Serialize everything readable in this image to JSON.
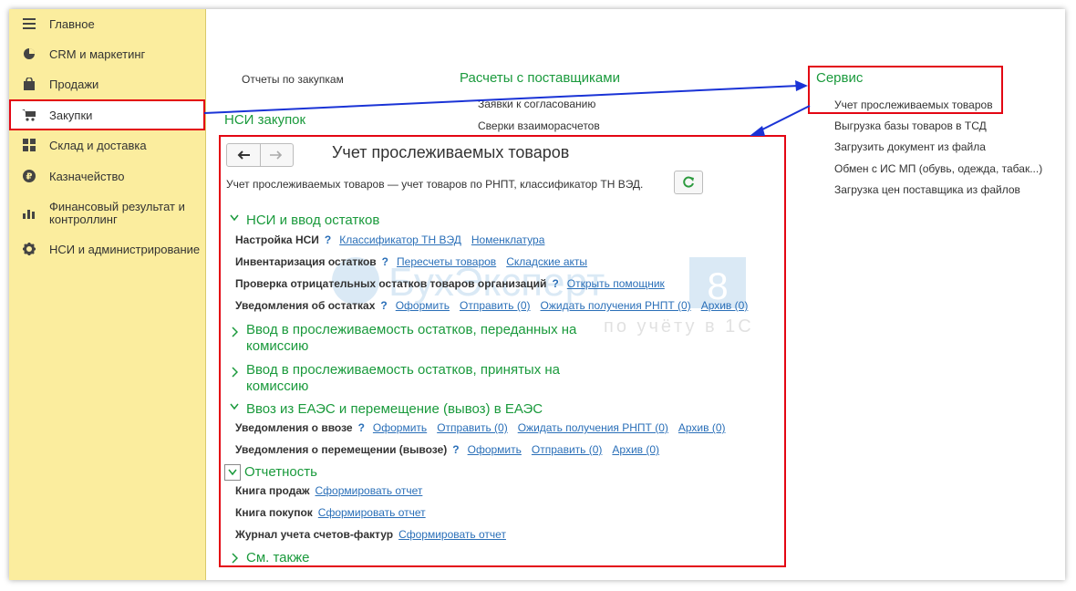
{
  "sidebar": {
    "items": [
      {
        "label": "Главное",
        "icon": "menu-icon"
      },
      {
        "label": "CRM и маркетинг",
        "icon": "pie-chart-icon"
      },
      {
        "label": "Продажи",
        "icon": "shopping-bag-icon"
      },
      {
        "label": "Закупки",
        "icon": "cart-icon"
      },
      {
        "label": "Склад и доставка",
        "icon": "warehouse-icon"
      },
      {
        "label": "Казначейство",
        "icon": "ruble-coin-icon"
      },
      {
        "label": "Финансовый результат и контроллинг",
        "icon": "bar-chart-icon"
      },
      {
        "label": "НСИ и администрирование",
        "icon": "gear-icon"
      }
    ],
    "active": "Закупки"
  },
  "main": {
    "reports_link": "Отчеты по закупкам",
    "settlements_header": "Расчеты с поставщиками",
    "approval_link": "Заявки к согласованию",
    "reconciliation_link": "Сверки взаиморасчетов",
    "nsi_header": "НСИ закупок"
  },
  "service": {
    "title": "Сервис",
    "items": [
      "Учет прослеживаемых товаров",
      "Выгрузка базы товаров в ТСД",
      "Загрузить документ из файла",
      "Обмен с ИС МП (обувь, одежда, табак...)",
      "Загрузка цен поставщика из файлов"
    ]
  },
  "panel": {
    "title": "Учет прослеживаемых товаров",
    "description": "Учет прослеживаемых товаров — учет товаров по РНПТ, классификатор ТН ВЭД.",
    "sections": {
      "nsi": "НСИ и ввод остатков",
      "commission_out": "Ввод в прослеживаемость остатков, переданных на комиссию",
      "commission_in": "Ввод в прослеживаемость остатков, принятых на комиссию",
      "eaes": "Ввоз из ЕАЭС и перемещение (вывоз) в ЕАЭС",
      "reports": "Отчетность",
      "see_also": "См. также"
    },
    "rows": {
      "nsi_setup": {
        "label": "Настройка НСИ",
        "q": "?",
        "links": [
          "Классификатор ТН ВЭД",
          "Номенклатура"
        ]
      },
      "inventory": {
        "label": "Инвентаризация остатков",
        "q": "?",
        "links": [
          "Пересчеты товаров",
          "Складские акты"
        ]
      },
      "negative": {
        "label": "Проверка отрицательных остатков товаров организаций",
        "q": "?",
        "links": [
          "Открыть помощник"
        ]
      },
      "stock_notices": {
        "label": "Уведомления об остатках",
        "q": "?",
        "links": [
          "Оформить",
          "Отправить (0)",
          "Ожидать получения РНПТ (0)",
          "Архив (0)"
        ]
      },
      "import_notices": {
        "label": "Уведомления о ввозе",
        "q": "?",
        "links": [
          "Оформить",
          "Отправить (0)",
          "Ожидать получения РНПТ (0)",
          "Архив (0)"
        ]
      },
      "move_notices": {
        "label": "Уведомления о перемещении (вывозе)",
        "q": "?",
        "links": [
          "Оформить",
          "Отправить (0)",
          "Архив (0)"
        ]
      },
      "sales_book": {
        "label": "Книга продаж",
        "links": [
          "Сформировать отчет"
        ]
      },
      "purchase_book": {
        "label": "Книга покупок",
        "links": [
          "Сформировать отчет"
        ]
      },
      "invoice_journal": {
        "label": "Журнал учета счетов-фактур",
        "links": [
          "Сформировать отчет"
        ]
      }
    }
  },
  "watermark": {
    "text": "БухЭксперт",
    "number": "8",
    "tagline": "по учёту в 1С"
  },
  "colors": {
    "sidebar_bg": "#fbed9e",
    "green": "#1a9a3c",
    "link": "#2a6fb8",
    "highlight": "#e30613",
    "arrow": "#1a33d6"
  }
}
